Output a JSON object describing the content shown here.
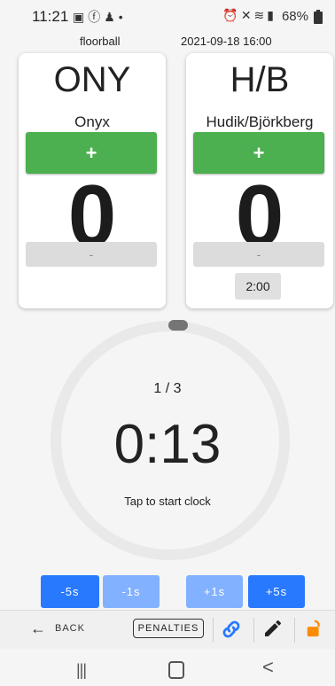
{
  "status_bar": {
    "time": "11:21",
    "left_icons": [
      "gallery-icon",
      "facebook-icon",
      "snapchat-icon",
      "dot-icon"
    ],
    "right_icons": [
      "alarm-icon",
      "mute-icon",
      "wifi-icon",
      "signal-icon"
    ],
    "battery": "68%"
  },
  "header": {
    "sport": "floorball",
    "datetime": "2021-09-18 16:00"
  },
  "home": {
    "abbr": "ONY",
    "name": "Onyx",
    "plus_label": "+",
    "score": "0",
    "minus_label": "-"
  },
  "away": {
    "abbr": "H/B",
    "name": "Hudik/Björkberg",
    "plus_label": "+",
    "score": "0",
    "minus_label": "-",
    "penalty_time": "2:00"
  },
  "clock": {
    "period": "1 / 3",
    "time": "0:13",
    "hint": "Tap to start clock"
  },
  "adjust_buttons": [
    "-5s",
    "-1s",
    "+1s",
    "+5s"
  ],
  "toolbar": {
    "back_arrow": "←",
    "back_label": "BACK",
    "penalties_label": "PENALTIES"
  },
  "navbar": {
    "recents": "|||",
    "back": "<"
  },
  "colors": {
    "green": "#4caf50",
    "blue": "#2979ff",
    "light_blue": "#82b1ff",
    "lock_orange": "#fb8c00"
  }
}
